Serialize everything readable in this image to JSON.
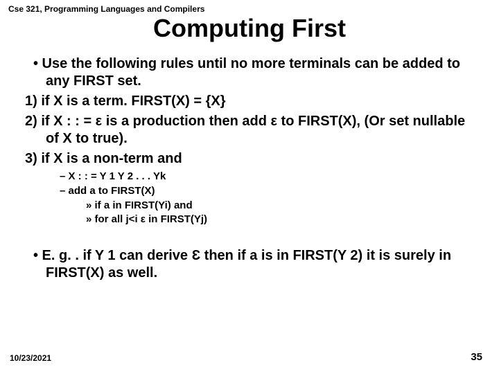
{
  "course_header": "Cse 321, Programming Languages and Compilers",
  "title": "Computing First",
  "bullets": {
    "b1": "•  Use the following rules until no more terminals can be added to any FIRST set.",
    "b2": "1) if X is a term. FIRST(X) = {X}",
    "b3": "2) if X : : = ε is  a production then add ε to FIRST(X), (Or set nullable of X to true).",
    "b4": "3) if X is a non-term and",
    "s1": "–  X : : = Y 1  Y 2  . . . Yk",
    "s2": "–  add a to FIRST(X)",
    "ss1": "»  if  a in FIRST(Yi) and",
    "ss2": "»  for all j<i  ε in FIRST(Yj)",
    "b5": "•  E. g. .  if Y 1 can derive Ɛ then  if a is in FIRST(Y 2) it is surely in FIRST(X) as well."
  },
  "footer": {
    "date": "10/23/2021",
    "page": "35"
  }
}
